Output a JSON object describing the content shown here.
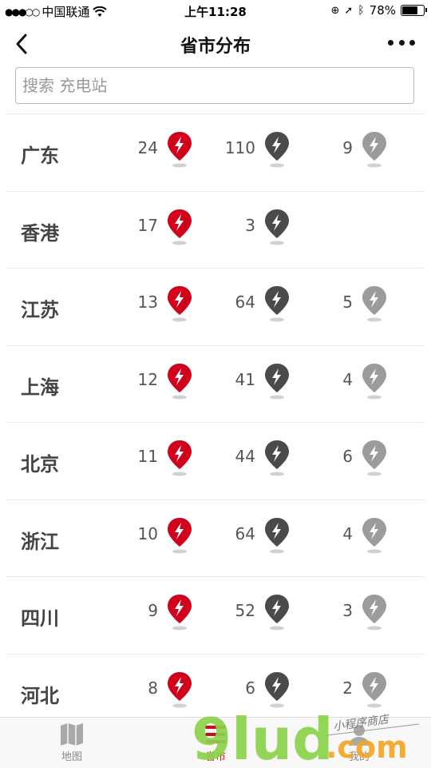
{
  "status": {
    "carrier": "中国联通",
    "time": "上午11:28",
    "battery": "78%",
    "battery_level": 0.78
  },
  "nav": {
    "title": "省市分布"
  },
  "search": {
    "placeholder": "搜索 充电站"
  },
  "colors": {
    "fast": "#d0021b",
    "slow": "#4a4a4a",
    "other": "#9b9b9b",
    "active_tab": "#c8101d"
  },
  "rows": [
    {
      "province": "广东",
      "fast": "24",
      "slow": "110",
      "other": "9"
    },
    {
      "province": "香港",
      "fast": "17",
      "slow": "3",
      "other": ""
    },
    {
      "province": "江苏",
      "fast": "13",
      "slow": "64",
      "other": "5"
    },
    {
      "province": "上海",
      "fast": "12",
      "slow": "41",
      "other": "4"
    },
    {
      "province": "北京",
      "fast": "11",
      "slow": "44",
      "other": "6"
    },
    {
      "province": "浙江",
      "fast": "10",
      "slow": "64",
      "other": "4"
    },
    {
      "province": "四川",
      "fast": "9",
      "slow": "52",
      "other": "3"
    },
    {
      "province": "河北",
      "fast": "8",
      "slow": "6",
      "other": "2"
    }
  ],
  "tabs": [
    {
      "label": "地图",
      "icon": "map-icon"
    },
    {
      "label": "省市",
      "icon": "list-icon",
      "active": true
    },
    {
      "label": "我的",
      "icon": "user-icon"
    }
  ],
  "watermark": {
    "text": "9lud",
    "domain": ".com",
    "sub": "小程序商店"
  }
}
